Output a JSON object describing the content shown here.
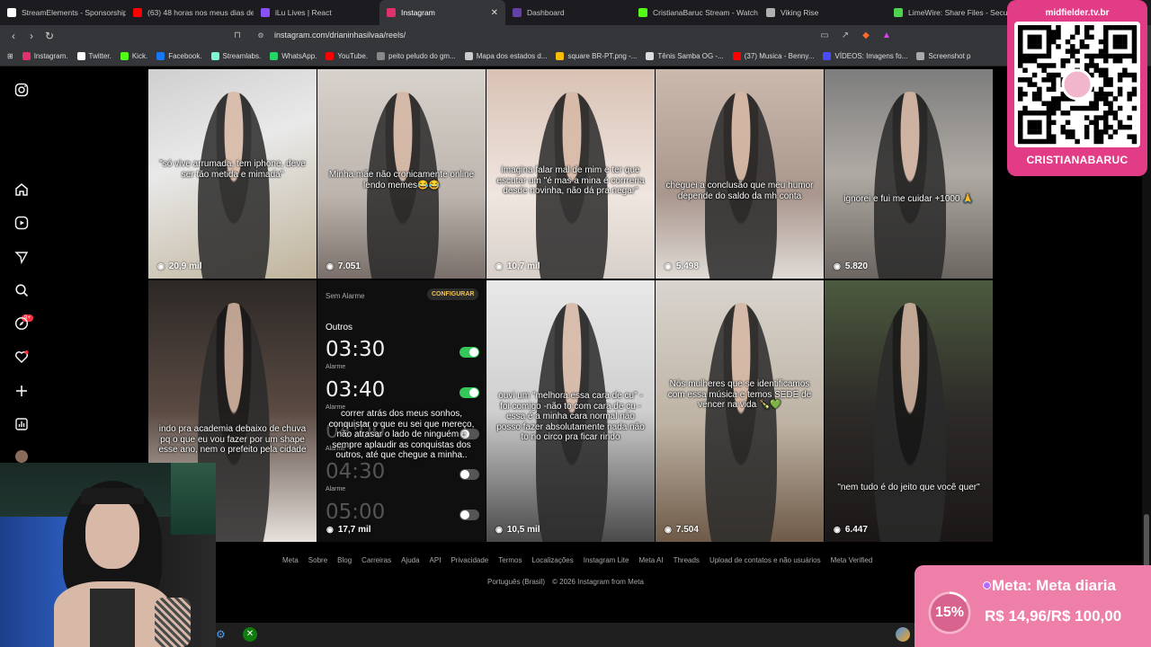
{
  "browser": {
    "tabs": [
      {
        "label": "StreamElements - Sponsorship",
        "fav_color": "#ffffff"
      },
      {
        "label": "(63) 48 horas nos meus dias de",
        "fav_color": "#ff0000"
      },
      {
        "label": "iLu Lives | React",
        "fav_color": "#8a4fff"
      },
      {
        "label": "Instagram",
        "fav_color": "#e1306c"
      },
      {
        "label": "Dashboard",
        "fav_color": "#6441a5"
      },
      {
        "label": "CristianaBaruc Stream - Watch",
        "fav_color": "#53fc18"
      },
      {
        "label": "Viking Rise",
        "fav_color": "#b0b0b0"
      },
      {
        "label": "LimeWire: Share Files - Secu",
        "fav_color": "#4ed34e"
      }
    ],
    "active_tab": "Instagram",
    "close_glyph": "✕",
    "url": "instagram.com/drianinhasilvaa/reels/",
    "bookmarks": [
      {
        "label": "Instagram.",
        "color": "#e1306c"
      },
      {
        "label": "Twitter.",
        "color": "#ffffff"
      },
      {
        "label": "Kick.",
        "color": "#53fc18"
      },
      {
        "label": "Facebook.",
        "color": "#1877f2"
      },
      {
        "label": "Streamlabs.",
        "color": "#80f5d2"
      },
      {
        "label": "WhatsApp.",
        "color": "#25d366"
      },
      {
        "label": "YouTube.",
        "color": "#ff0000"
      },
      {
        "label": "peito peludo do gm...",
        "color": "#888888"
      },
      {
        "label": "Mapa dos estados d...",
        "color": "#cccccc"
      },
      {
        "label": "square BR-PT.png -...",
        "color": "#fbbc04"
      },
      {
        "label": "Tênis Samba OG -...",
        "color": "#dddddd"
      },
      {
        "label": "(37) Musica - Benny...",
        "color": "#ff0000"
      },
      {
        "label": "VÍDEOS: Imagens fo...",
        "color": "#4a4aff"
      },
      {
        "label": "Screenshot p",
        "color": "#aaaaaa"
      }
    ]
  },
  "reels": [
    {
      "caption": "\"só vive arrumada, tem iphone, deve ser tão metida e mimada\"",
      "views": "20,9 mil"
    },
    {
      "caption": "Minha mãe não cronicamente online lendo memes😂😂",
      "views": "7.051"
    },
    {
      "caption": "imagina falar mal de mim e ter que escutar um \"é mas a mina é corrreria desde novinha, não dá pra negar\"",
      "views": "10,7 mil"
    },
    {
      "caption": "cheguei a conclusão que meu humor depende do saldo da mh conta",
      "views": "5.498"
    },
    {
      "caption": "ignorei e fui me cuidar +1000 🙏",
      "views": "5.820"
    },
    {
      "caption": "indo pra academia debaixo de chuva pq o que eu vou fazer por um shape esse ano, nem o prefeito pela cidade",
      "views": ""
    },
    {
      "caption": "correr atrás dos meus sonhos, conquistar o que eu sei que mereço, não atrasar o lado de ninguém e sempre aplaudir as conquistas dos outros, até que chegue a minha..",
      "views": "17,7 mil"
    },
    {
      "caption": "ouvi um \"melhora essa cara de cu\" -foi comigo -não to com cara de cu -essa é a minha cara normal não posso fazer absolutamente nada não to no circo pra ficar rindo",
      "views": "10,5 mil"
    },
    {
      "caption": "Nós mulheres que se identificamos com essa música e temos SEDE de vencer na vida 🍾💚",
      "views": "7.504"
    },
    {
      "caption": "\"nem tudo é do jeito que você quer\"",
      "views": "6.447"
    }
  ],
  "alarm_screen": {
    "header_left": "Sem Alarme",
    "header_button": "CONFIGURAR",
    "section": "Outros",
    "alarms": [
      {
        "time": "03:30",
        "label": "Alarme",
        "on": true
      },
      {
        "time": "03:40",
        "label": "Alarme",
        "on": true
      },
      {
        "time": "04:00",
        "label": "Alarme",
        "on": false
      },
      {
        "time": "04:30",
        "label": "Alarme",
        "on": false
      },
      {
        "time": "05:00",
        "label": "",
        "on": false
      }
    ]
  },
  "footer": {
    "links": [
      "Meta",
      "Sobre",
      "Blog",
      "Carreiras",
      "Ajuda",
      "API",
      "Privacidade",
      "Termos",
      "Localizações",
      "Instagram Lite",
      "Meta AI",
      "Threads",
      "Upload de contatos e não usuários",
      "Meta Verified"
    ],
    "language": "Português (Brasil)",
    "copyright": "© 2026 Instagram from Meta"
  },
  "overlay_qr": {
    "site": "midfielder.tv.br",
    "name": "CRISTIANABARUC",
    "color": "#e23c87"
  },
  "overlay_goal": {
    "percent": "15%",
    "progress": 0.1496,
    "title": "Meta: Meta diaria",
    "amount": "R$ 14,96/R$ 100,00",
    "color": "#ee7fa8"
  },
  "rail": {
    "notification_badge": "9+"
  }
}
